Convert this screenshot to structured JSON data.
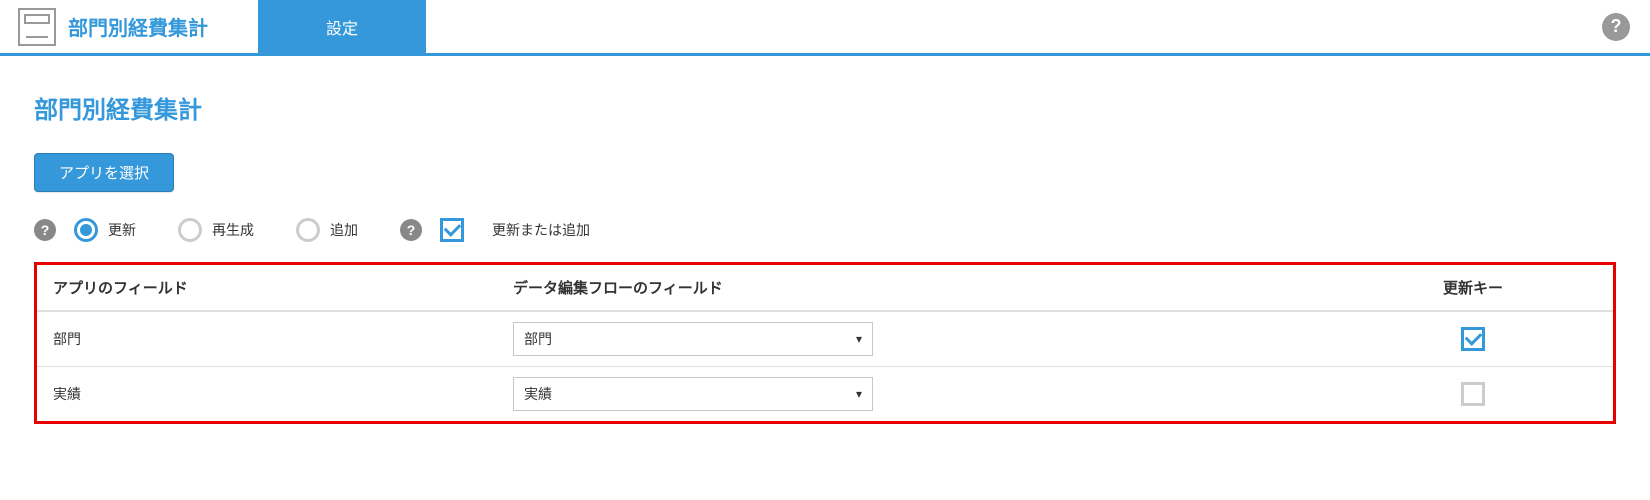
{
  "header": {
    "title": "部門別経費集計",
    "tab": "設定"
  },
  "page": {
    "title": "部門別経費集計",
    "select_app_label": "アプリを選択"
  },
  "modes": {
    "r1": "更新",
    "r2": "再生成",
    "r3": "追加",
    "cb": "更新または追加"
  },
  "table": {
    "h1": "アプリのフィールド",
    "h2": "データ編集フローのフィールド",
    "h3": "更新キー",
    "rows": [
      {
        "app": "部門",
        "flow": "部門",
        "key": true
      },
      {
        "app": "実績",
        "flow": "実績",
        "key": false
      }
    ]
  }
}
